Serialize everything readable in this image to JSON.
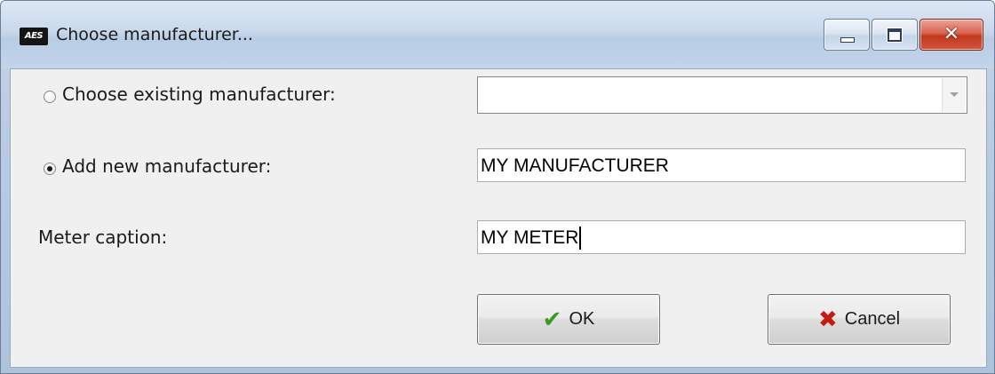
{
  "window": {
    "title": "Choose manufacturer...",
    "app_icon_text": "AES",
    "close_glyph": "✕"
  },
  "form": {
    "existing_label": "Choose existing manufacturer:",
    "existing_selected": false,
    "existing_value": "",
    "new_label": "Add new manufacturer:",
    "new_selected": true,
    "new_value": "MY MANUFACTURER",
    "caption_label": "Meter caption:",
    "caption_value": "MY METER"
  },
  "buttons": {
    "ok_label": "OK",
    "ok_icon": "check-icon",
    "ok_glyph": "✔",
    "cancel_label": "Cancel",
    "cancel_icon": "x-icon",
    "cancel_glyph": "✖"
  },
  "colors": {
    "ok_icon": "#3c9a1f",
    "cancel_icon": "#c41a10",
    "close_button": "#c2371d"
  }
}
